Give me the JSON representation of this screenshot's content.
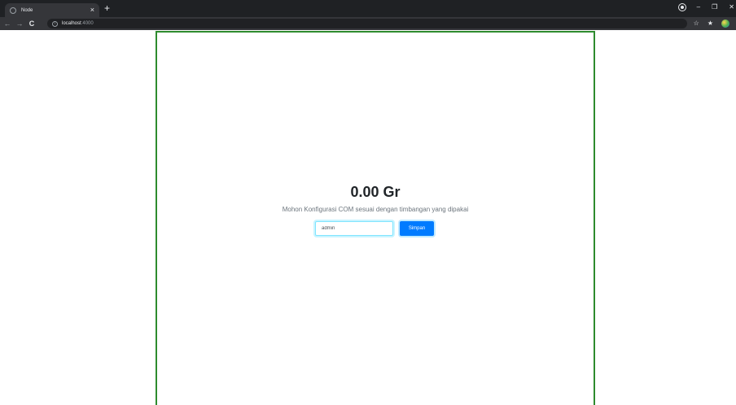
{
  "browser": {
    "tab_title": "Node",
    "tab_close": "×",
    "new_tab": "+",
    "url_host": "localhost",
    "url_port": ":4000",
    "window_controls": {
      "minimize": "–",
      "restore": "❐",
      "close": "✕"
    },
    "nav": {
      "back": "←",
      "forward": "→",
      "reload": "C"
    },
    "toolbar_icons": {
      "star": "☆",
      "extensions": "★"
    }
  },
  "page": {
    "weight_display": "0.00 Gr",
    "message": "Mohon Konfigurasi COM sesuai dengan timbangan yang dipakai",
    "com_input_value": "admin",
    "save_button_label": "Simpan"
  },
  "colors": {
    "panel_border": "#2e8b2e",
    "primary_button": "#007bff",
    "input_focus": "#80e5ff"
  }
}
